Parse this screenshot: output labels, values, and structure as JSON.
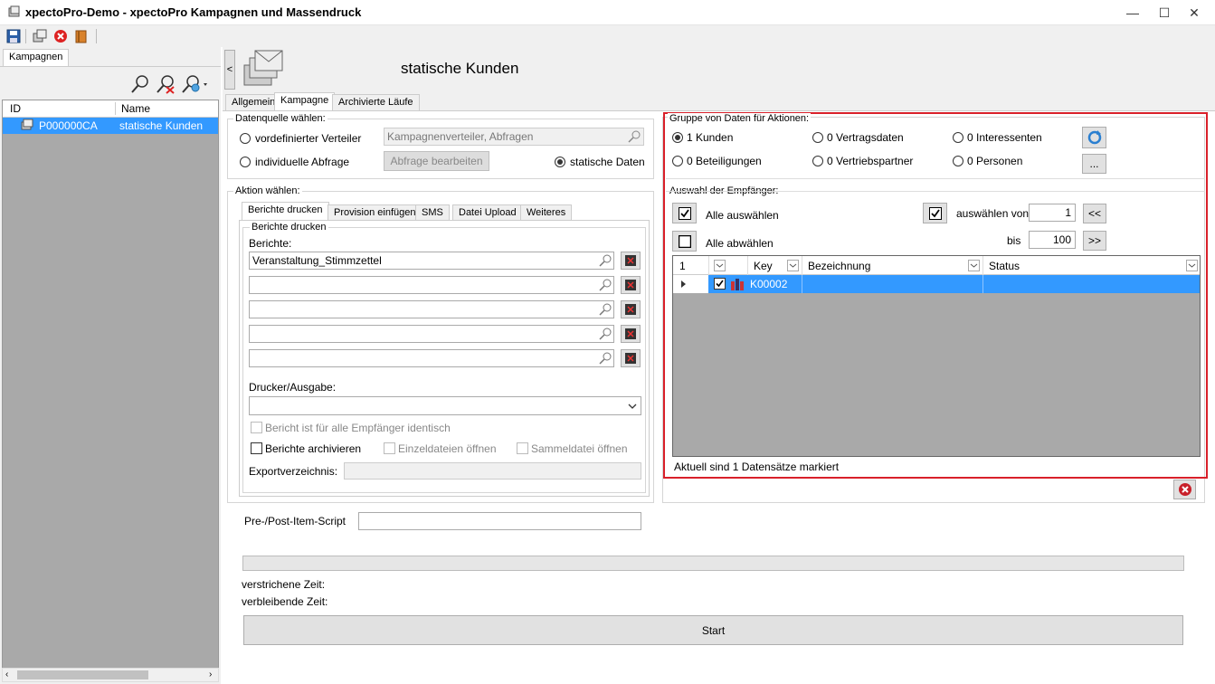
{
  "window": {
    "title": "xpectoPro-Demo - xpectoPro Kampagnen und Massendruck",
    "minimize": "—",
    "maximize": "☐",
    "close": "✕"
  },
  "toolbar": {
    "icons": [
      "save-icon",
      "copy-icon",
      "cancel-icon",
      "book-icon"
    ]
  },
  "left": {
    "tab": "Kampagnen",
    "columns": [
      "ID",
      "Name"
    ],
    "rows": [
      {
        "id": "P000000CA",
        "name": "statische Kunden"
      }
    ]
  },
  "header": {
    "collapse": "<",
    "title": "statische Kunden"
  },
  "tabs": [
    "Allgemein",
    "Kampagne",
    "Archivierte Läufe"
  ],
  "datasource": {
    "legend": "Datenquelle wählen:",
    "opt1": "vordefinierter Verteiler",
    "opt1_value": "Kampagnenverteiler, Abfragen",
    "opt2": "individuelle Abfrage",
    "edit_button": "Abfrage bearbeiten",
    "opt3": "statische Daten"
  },
  "action": {
    "legend": "Aktion wählen:",
    "tabs": [
      "Berichte drucken",
      "Provision einfügen",
      "SMS",
      "Datei Upload",
      "Weiteres"
    ],
    "inner_legend": "Berichte drucken",
    "reports_label": "Berichte:",
    "reports": [
      "Veranstaltung_Stimmzettel",
      "",
      "",
      "",
      ""
    ],
    "printer_label": "Drucker/Ausgabe:",
    "printer_value": "",
    "same_report": "Bericht ist für alle Empfänger identisch",
    "archive": "Berichte archivieren",
    "single_files": "Einzeldateien öffnen",
    "collective_file": "Sammeldatei öffnen",
    "export_label": "Exportverzeichnis:"
  },
  "script_label": "Pre-/Post-Item-Script",
  "group": {
    "legend": "Gruppe von Daten für Aktionen:",
    "options": [
      "1 Kunden",
      "0 Vertragsdaten",
      "0 Interessenten",
      "0 Beteiligungen",
      "0 Vertriebspartner",
      "0 Personen"
    ],
    "more_button": "..."
  },
  "recipients": {
    "legend": "Auswahl der Empfänger:",
    "select_all": "Alle auswählen",
    "deselect_all": "Alle abwählen",
    "select_from": "auswählen von",
    "from_value": "1",
    "to_label": "bis",
    "to_value": "100",
    "prev": "<<",
    "next": ">>",
    "columns": [
      "1",
      "",
      "Key",
      "Bezeichnung",
      "Status"
    ],
    "rows": [
      {
        "key": "K00002",
        "bezeichnung": "",
        "status": ""
      }
    ],
    "status": "Aktuell sind 1 Datensätze markiert"
  },
  "elapsed_label": "verstrichene Zeit:",
  "remaining_label": "verbleibende Zeit:",
  "start_button": "Start",
  "colors": {
    "selection": "#3399ff",
    "highlight_frame": "#d9202a"
  }
}
